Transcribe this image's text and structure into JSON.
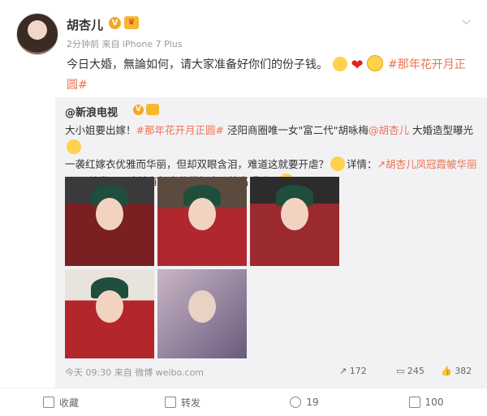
{
  "post": {
    "author": "胡杏儿",
    "meta": "2分钟前 来自 iPhone 7 Plus",
    "text": "今日大婚，無論如何，请大家准备好你们的份子钱。",
    "hashtag": "#那年花开月正圆#",
    "chevron": "⌵"
  },
  "repost": {
    "author": "@新浪电视",
    "line1_a": "大小姐要出嫁！",
    "line1_tag": "#那年花开月正圆#",
    "line1_b": " 泾阳商圈唯一女\"富二代\"胡咏梅",
    "line1_mention": "@胡杏儿",
    "line1_c": " 大婚造型曝光",
    "line2_a": "一袭红嫁衣优雅而华丽，但却双眼含泪，难道这就要开虐？",
    "line2_b": "详情：",
    "line2_link": "↗胡杏儿凤冠霞帔华丽",
    "line3_link": "动人",
    "line3_b": " 转发+评论就有机会获得胡杏儿签名照哟~",
    "time": "今天 09:30 来自 微博 weibo.com",
    "forwards": "172",
    "comments": "245",
    "likes": "382"
  },
  "actions": {
    "favorite": "收藏",
    "forward": "转发",
    "comment": "19",
    "like": "100"
  },
  "icons": [
    "chevron-down-icon",
    "verified-icon",
    "crown-icon",
    "forward-icon",
    "comment-icon",
    "like-icon",
    "star-icon"
  ]
}
